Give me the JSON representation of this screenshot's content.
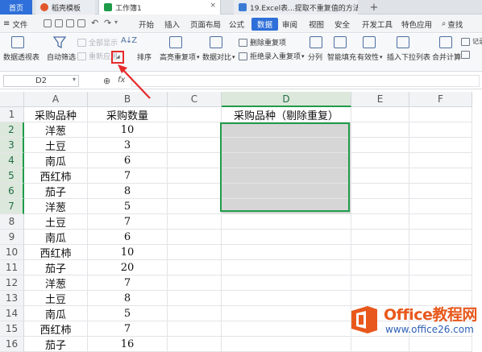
{
  "tabs": {
    "home": "首页",
    "daoke": "稻壳模板",
    "workbook": "工作簿1",
    "web": "19.Excel表...提取不重复值的方法",
    "close": "×",
    "new_tab": "+"
  },
  "menu": {
    "file": "文件",
    "items": [
      "开始",
      "插入",
      "页面布局",
      "公式",
      "数据",
      "审阅",
      "视图",
      "安全",
      "开发工具",
      "特色应用"
    ],
    "active_index": 4,
    "search": "查找"
  },
  "ribbon": {
    "pivot": "数据透视表",
    "autofilter": "自动筛选",
    "show_all": "全部显示",
    "reapply": "重新应用",
    "sort": "排序",
    "highlight_dup": "高亮重复项",
    "data_compare": "数据对比",
    "remove_dup": "删除重复项",
    "reject_dup": "拒绝录入重复项",
    "split": "分列",
    "flash_fill": "智能填充",
    "validity": "有效性",
    "dropdown_list": "插入下拉列表",
    "consolidate": "合并计算",
    "record": "记录单"
  },
  "formula_bar": {
    "name_box": "D2",
    "fx": "fx",
    "value": ""
  },
  "columns": [
    "A",
    "B",
    "C",
    "D",
    "E",
    "F"
  ],
  "selected_column": "D",
  "rows": [
    "1",
    "2",
    "3",
    "4",
    "5",
    "6",
    "7",
    "8",
    "9",
    "10",
    "11",
    "12",
    "13",
    "14",
    "15",
    "16"
  ],
  "cells": {
    "A": [
      "采购品种",
      "洋葱",
      "土豆",
      "南瓜",
      "西红柿",
      "茄子",
      "洋葱",
      "土豆",
      "南瓜",
      "西红柿",
      "茄子",
      "洋葱",
      "土豆",
      "南瓜",
      "西红柿",
      "茄子"
    ],
    "B": [
      "采购数量",
      "10",
      "3",
      "6",
      "7",
      "8",
      "5",
      "7",
      "6",
      "10",
      "20",
      "7",
      "8",
      "5",
      "7",
      "16"
    ],
    "D1": "采购品种（剔除重复）"
  },
  "watermark": {
    "title": "Office教程网",
    "url": "www.office26.com"
  },
  "colors": {
    "accent_blue": "#2e6fd9",
    "select_green": "#1f9c4a",
    "highlight_red": "#e52a2a",
    "watermark_orange": "#e8581c"
  }
}
